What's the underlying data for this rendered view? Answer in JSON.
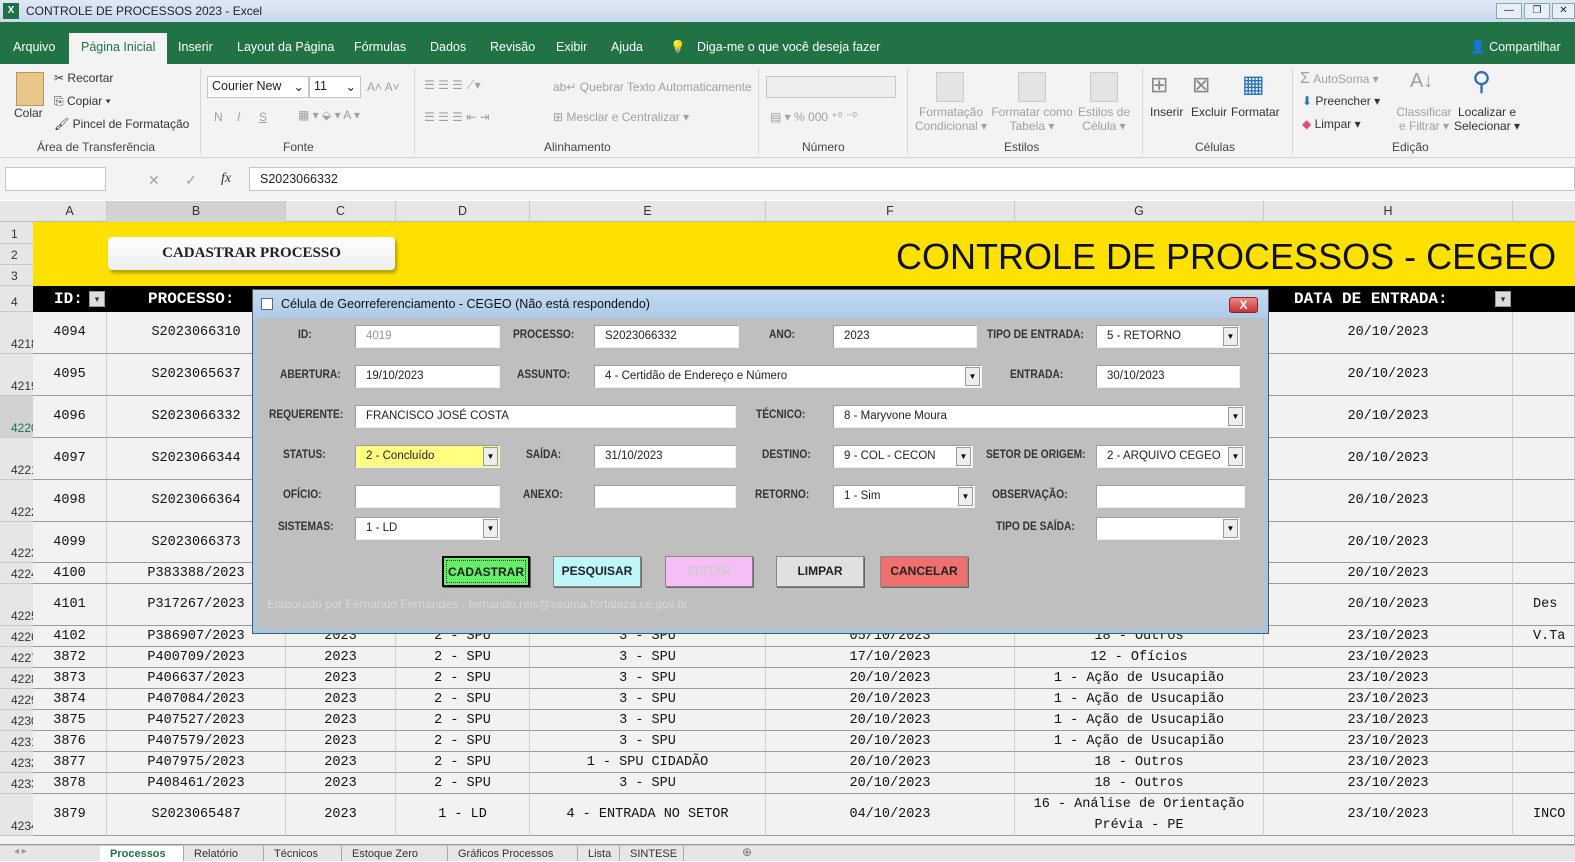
{
  "window": {
    "title": "CONTROLE DE PROCESSOS 2023 - Excel",
    "app_icon": "excel-icon"
  },
  "ribbon_tabs": [
    "Arquivo",
    "Página Inicial",
    "Inserir",
    "Layout da Página",
    "Fórmulas",
    "Dados",
    "Revisão",
    "Exibir",
    "Ajuda"
  ],
  "tell_me": "Diga-me o que você deseja fazer",
  "share": "Compartilhar",
  "ribbon": {
    "clipboard": {
      "paste": "Colar",
      "cut": "Recortar",
      "copy": "Copiar",
      "format_painter": "Pincel de Formatação",
      "group": "Área de Transferência"
    },
    "font": {
      "name": "Courier New",
      "size": "11",
      "bold": "N",
      "italic": "I",
      "underline": "S",
      "group": "Fonte"
    },
    "alignment": {
      "wrap": "Quebrar Texto Automaticamente",
      "merge": "Mesclar e Centralizar",
      "group": "Alinhamento"
    },
    "number": {
      "percent": "%",
      "thousands": "000",
      "group": "Número"
    },
    "styles": {
      "conditional": [
        "Formatação",
        "Condicional"
      ],
      "table": [
        "Formatar como",
        "Tabela"
      ],
      "cell": [
        "Estilos de",
        "Célula"
      ],
      "group": "Estilos"
    },
    "cells": {
      "insert": "Inserir",
      "delete": "Excluir",
      "format": "Formatar",
      "group": "Células"
    },
    "editing": {
      "autosum": "AutoSoma",
      "fill": "Preencher",
      "clear": "Limpar",
      "sort": [
        "Classificar",
        "e Filtrar"
      ],
      "find": [
        "Localizar e",
        "Selecionar"
      ],
      "group": "Edição"
    }
  },
  "formula_bar": {
    "name_box": "",
    "fx": "fx",
    "value": "S2023066332"
  },
  "columns": [
    "A",
    "B",
    "C",
    "D",
    "E",
    "F",
    "G",
    "H"
  ],
  "sheet": {
    "rows_top": [
      "1",
      "2",
      "3",
      "4"
    ],
    "cadastrar_button": "CADASTRAR PROCESSO",
    "title": "CONTROLE DE PROCESSOS - CEGEO",
    "headers": {
      "id": "ID:",
      "processo": "PROCESSO:",
      "data_entrada": "DATA DE ENTRADA:"
    },
    "rows": [
      {
        "n": "4218",
        "cells": [
          "4094",
          "S2023066310",
          "",
          "",
          "",
          "",
          "",
          "20/10/2023",
          ""
        ]
      },
      {
        "n": "4219",
        "cells": [
          "4095",
          "S2023065637",
          "",
          "",
          "",
          "",
          "",
          "20/10/2023",
          ""
        ]
      },
      {
        "n": "4220",
        "cells": [
          "4096",
          "S2023066332",
          "",
          "",
          "",
          "",
          "",
          "20/10/2023",
          ""
        ]
      },
      {
        "n": "4221",
        "cells": [
          "4097",
          "S2023066344",
          "",
          "",
          "",
          "",
          "",
          "20/10/2023",
          ""
        ]
      },
      {
        "n": "4222",
        "cells": [
          "4098",
          "S2023066364",
          "",
          "",
          "",
          "",
          "",
          "20/10/2023",
          ""
        ]
      },
      {
        "n": "4223",
        "cells": [
          "4099",
          "S2023066373",
          "",
          "",
          "",
          "",
          "",
          "20/10/2023",
          ""
        ]
      },
      {
        "n": "4224",
        "cells": [
          "4100",
          "P383388/2023",
          "",
          "",
          "",
          "",
          "",
          "20/10/2023",
          ""
        ]
      },
      {
        "n": "4225",
        "cells": [
          "4101",
          "P317267/2023",
          "",
          "",
          "",
          "",
          "",
          "20/10/2023",
          "Des"
        ]
      },
      {
        "n": "4226",
        "cells": [
          "4102",
          "P386907/2023",
          "2023",
          "2 - SPU",
          "3 - SPU",
          "05/10/2023",
          "18 - Outros",
          "23/10/2023",
          "V.Ta"
        ]
      },
      {
        "n": "4227",
        "cells": [
          "3872",
          "P400709/2023",
          "2023",
          "2 - SPU",
          "3 - SPU",
          "17/10/2023",
          "12 - Ofícios",
          "23/10/2023",
          ""
        ]
      },
      {
        "n": "4228",
        "cells": [
          "3873",
          "P406637/2023",
          "2023",
          "2 - SPU",
          "3 - SPU",
          "20/10/2023",
          "1 - Ação de Usucapião",
          "23/10/2023",
          ""
        ]
      },
      {
        "n": "4229",
        "cells": [
          "3874",
          "P407084/2023",
          "2023",
          "2 - SPU",
          "3 - SPU",
          "20/10/2023",
          "1 - Ação de Usucapião",
          "23/10/2023",
          ""
        ]
      },
      {
        "n": "4230",
        "cells": [
          "3875",
          "P407527/2023",
          "2023",
          "2 - SPU",
          "3 - SPU",
          "20/10/2023",
          "1 - Ação de Usucapião",
          "23/10/2023",
          ""
        ]
      },
      {
        "n": "4231",
        "cells": [
          "3876",
          "P407579/2023",
          "2023",
          "2 - SPU",
          "3 - SPU",
          "20/10/2023",
          "1 - Ação de Usucapião",
          "23/10/2023",
          ""
        ]
      },
      {
        "n": "4232",
        "cells": [
          "3877",
          "P407975/2023",
          "2023",
          "2 - SPU",
          "1 - SPU CIDADÃO",
          "20/10/2023",
          "18 - Outros",
          "23/10/2023",
          ""
        ]
      },
      {
        "n": "4233",
        "cells": [
          "3878",
          "P408461/2023",
          "2023",
          "2 - SPU",
          "3 - SPU",
          "20/10/2023",
          "18 - Outros",
          "23/10/2023",
          ""
        ]
      },
      {
        "n": "4234",
        "cells": [
          "3879",
          "S2023065487",
          "2023",
          "1 - LD",
          "4 - ENTRADA NO SETOR",
          "04/10/2023",
          "16 - Análise de Orientação Prévia - PE",
          "23/10/2023",
          "INCO"
        ]
      }
    ]
  },
  "sheet_tabs": [
    "Processos",
    "Relatório",
    "Técnicos",
    "Estoque Zero",
    "Gráficos Processos",
    "Lista",
    "SINTESE"
  ],
  "dialog": {
    "title": "Célula de Georreferenciamento - CEGEO (Não está respondendo)",
    "close": "X",
    "fields": {
      "id": {
        "label": "ID:",
        "value": "4019"
      },
      "processo": {
        "label": "PROCESSO:",
        "value": "S2023066332"
      },
      "ano": {
        "label": "ANO:",
        "value": "2023"
      },
      "tipo_entrada": {
        "label": "TIPO DE ENTRADA:",
        "value": "5 - RETORNO"
      },
      "abertura": {
        "label": "ABERTURA:",
        "value": "19/10/2023"
      },
      "assunto": {
        "label": "ASSUNTO:",
        "value": "4 - Certidão de Endereço e Número"
      },
      "entrada": {
        "label": "ENTRADA:",
        "value": "30/10/2023"
      },
      "requerente": {
        "label": "REQUERENTE:",
        "value": "FRANCISCO JOSÉ COSTA"
      },
      "tecnico": {
        "label": "TÉCNICO:",
        "value": "8 - Maryvone Moura"
      },
      "status": {
        "label": "STATUS:",
        "value": "2 - Concluído"
      },
      "saida": {
        "label": "SAÍDA:",
        "value": "31/10/2023"
      },
      "destino": {
        "label": "DESTINO:",
        "value": "9 - COL - CECON"
      },
      "setor_origem": {
        "label": "SETOR DE ORIGEM:",
        "value": "2 - ARQUIVO CEGEO"
      },
      "oficio": {
        "label": "OFÍCIO:",
        "value": ""
      },
      "anexo": {
        "label": "ANEXO:",
        "value": ""
      },
      "retorno": {
        "label": "RETORNO:",
        "value": "1 - Sim"
      },
      "observacao": {
        "label": "OBSERVAÇÃO:",
        "value": ""
      },
      "sistemas": {
        "label": "SISTEMAS:",
        "value": "1 - LD"
      },
      "tipo_saida": {
        "label": "TIPO DE SAÍDA:",
        "value": ""
      }
    },
    "buttons": {
      "cadastrar": "CADASTRAR",
      "pesquisar": "PESQUISAR",
      "editar": "EDITAR",
      "limpar": "LIMPAR",
      "cancelar": "CANCELAR"
    },
    "footer": "Elaborado por Fernando Fernandes - fernando.reis@seuma.fortaleza.ce.gov.br"
  },
  "colors": {
    "excel_green": "#217346",
    "header_yellow": "#ffe100",
    "status_yellow": "#ffff80",
    "btn_cadastrar": "#66ee66",
    "btn_pesquisar": "#bdf7f7",
    "btn_editar": "#f7bdf7",
    "btn_limpar": "#e0e0e0",
    "btn_cancelar": "#f07070"
  }
}
